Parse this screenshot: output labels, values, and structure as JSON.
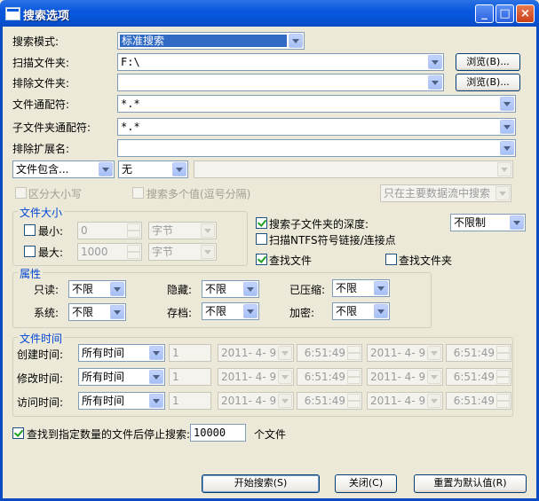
{
  "window": {
    "title": "搜索选项"
  },
  "search_mode": {
    "label": "搜索模式:",
    "value": "标准搜索"
  },
  "scan_folder": {
    "label": "扫描文件夹:",
    "value": "F:\\",
    "browse": "浏览(B)..."
  },
  "exclude_folder": {
    "label": "排除文件夹:",
    "value": "",
    "browse": "浏览(B)..."
  },
  "file_wildcard": {
    "label": "文件通配符:",
    "value": "*.*"
  },
  "subfolder_wildcard": {
    "label": "子文件夹通配符:",
    "value": "*.*"
  },
  "exclude_ext": {
    "label": "排除扩展名:",
    "value": ""
  },
  "contains": {
    "mode": "文件包含...",
    "option": "无",
    "text": ""
  },
  "options_disabled": {
    "case_sensitive": "区分大小写",
    "multi_values": "搜索多个值(逗号分隔)",
    "stream": "只在主要数据流中搜索"
  },
  "file_size": {
    "legend": "文件大小",
    "min_label": "最小:",
    "min_value": "0",
    "min_unit": "字节",
    "max_label": "最大:",
    "max_value": "1000",
    "max_unit": "字节"
  },
  "subfolder_depth": {
    "label": "搜索子文件夹的深度:",
    "checked": true,
    "value": "不限制"
  },
  "scan_ntfs": {
    "label": "扫描NTFS符号链接/连接点",
    "checked": false
  },
  "find_files": {
    "label": "查找文件",
    "checked": true
  },
  "find_folders": {
    "label": "查找文件夹",
    "checked": false
  },
  "attributes": {
    "legend": "属性",
    "readonly": {
      "label": "只读:",
      "value": "不限"
    },
    "hidden": {
      "label": "隐藏:",
      "value": "不限"
    },
    "compressed": {
      "label": "已压缩:",
      "value": "不限"
    },
    "system": {
      "label": "系统:",
      "value": "不限"
    },
    "archive": {
      "label": "存档:",
      "value": "不限"
    },
    "encrypted": {
      "label": "加密:",
      "value": "不限"
    }
  },
  "file_time": {
    "legend": "文件时间",
    "rows": [
      {
        "label": "创建时间:",
        "mode": "所有时间",
        "num": "1",
        "date1": "2011- 4- 9",
        "time1": "6:51:49",
        "date2": "2011- 4- 9",
        "time2": "6:51:49"
      },
      {
        "label": "修改时间:",
        "mode": "所有时间",
        "num": "1",
        "date1": "2011- 4- 9",
        "time1": "6:51:49",
        "date2": "2011- 4- 9",
        "time2": "6:51:49"
      },
      {
        "label": "访问时间:",
        "mode": "所有时间",
        "num": "1",
        "date1": "2011- 4- 9",
        "time1": "6:51:49",
        "date2": "2011- 4- 9",
        "time2": "6:51:49"
      }
    ]
  },
  "stop_after": {
    "label": "查找到指定数量的文件后停止搜索:",
    "checked": true,
    "value": "10000",
    "suffix": "个文件"
  },
  "buttons": {
    "start": "开始搜索(S)",
    "close": "关闭(C)",
    "reset": "重置为默认值(R)"
  }
}
